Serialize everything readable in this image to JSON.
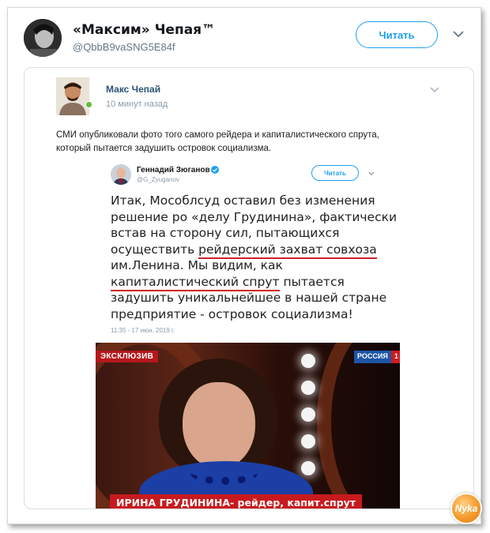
{
  "tweet": {
    "author_name": "«Максим» Чепая™",
    "author_handle": "@QbbB9vaSNG5E84f",
    "follow_label": "Читать"
  },
  "vk_post": {
    "author_name": "Макс Чепай",
    "time": "10 минут назад",
    "text_lines": [
      "СМИ опубликовали фото того самого рейдера и капиталистического спрута,",
      "который пытается задушить островок социализма."
    ]
  },
  "quoted_tweet": {
    "author_name": "Геннадий Зюганов",
    "author_handle": "@G_Zyuganov",
    "follow_label": "Читать",
    "lines": {
      "l1": "Итак, Мособлсуд оставил без изменения",
      "l2": "решение ро «делу Грудинина»,  фактически",
      "l3": "встав на сторону сил, пытающихся",
      "l4a": "осуществить ",
      "l4b": "рейдерский захват совхоза",
      "l5": "им.Ленина. Мы видим, как",
      "l6a": "капиталистический спрут",
      "l6b": " пытается",
      "l7": "задушить уникальнейшее в нашей стране",
      "l8": "предприятие - островок социализма!"
    },
    "date": "11:35 - 17 июн. 2019 г."
  },
  "tv_still": {
    "exclusive_label": "ЭКСКЛЮЗИВ",
    "channel_name": "РОССИЯ",
    "channel_number": "1",
    "caption_name": "ИРИНА ГРУДИНИНА",
    "caption_rest": " - рейдер, капит.спрут"
  },
  "watermark": "Nyka",
  "colors": {
    "accent": "#1da1f2",
    "underline": "#d21f2a",
    "caption_bg": "#c71a1e"
  }
}
